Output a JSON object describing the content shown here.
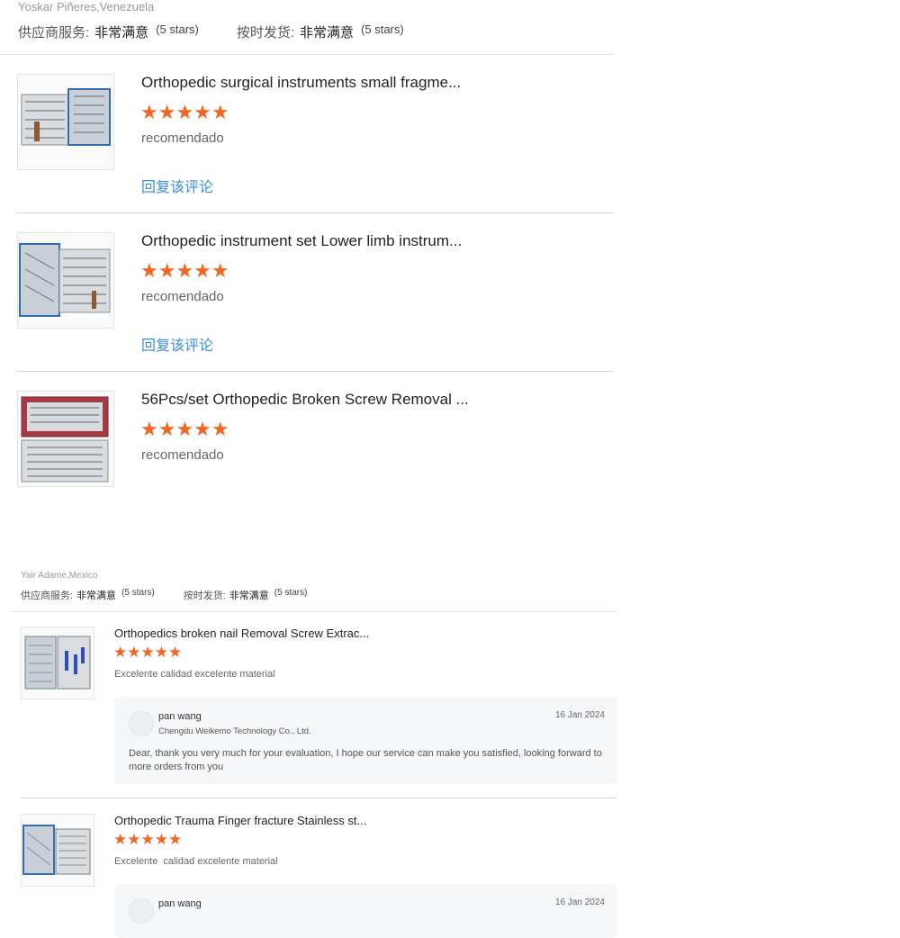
{
  "top_section": {
    "reviewer": "Yoskar Piñeres,Venezuela",
    "ratings": [
      {
        "label": "供应商服务:",
        "value": "非常满意",
        "stars_text": "(5 stars)"
      },
      {
        "label": "按时发货:",
        "value": "非常满意",
        "stars_text": "(5 stars)"
      }
    ],
    "items": [
      {
        "title": "Orthopedic surgical instruments small fragme...",
        "rating": "★★★★★",
        "comment": "recomendado",
        "reply_link": "回复该评论",
        "thumb_icon": "instrument-tray-icon"
      },
      {
        "title": "Orthopedic instrument set Lower limb instrum...",
        "rating": "★★★★★",
        "comment": "recomendado",
        "reply_link": "回复该评论",
        "thumb_icon": "instrument-tray-icon"
      },
      {
        "title": "56Pcs/set Orthopedic Broken Screw Removal ...",
        "rating": "★★★★★",
        "comment": "recomendado",
        "thumb_icon": "instrument-tray-icon"
      }
    ]
  },
  "bottom_section": {
    "reviewer": "Yair Adame,Mexico",
    "ratings": [
      {
        "label": "供应商服务:",
        "value": "非常满意",
        "stars_text": "(5 stars)"
      },
      {
        "label": "按时发货:",
        "value": "非常满意",
        "stars_text": "(5 stars)"
      }
    ],
    "items": [
      {
        "title": "Orthopedics broken nail Removal Screw Extrac...",
        "rating": "★★★★★",
        "comment": "Excelente calidad excelente material",
        "reply": {
          "name": "pan wang",
          "company": "Chengdu Weikemo Technology Co., Ltd.",
          "date": "16 Jan 2024",
          "text": "Dear, thank you very much for your evaluation, I hope our service can make you satisfied, looking forward to more orders from you"
        }
      },
      {
        "title": "Orthopedic Trauma Finger fracture Stainless st...",
        "rating": "★★★★★",
        "comment": "Excelente  calidad excelente material",
        "reply": {
          "name": "pan wang",
          "date": "16 Jan 2024"
        }
      }
    ]
  },
  "colors": {
    "star": "#f26522",
    "link": "#3a8ede",
    "reply_bg": "#f5f6f8"
  }
}
